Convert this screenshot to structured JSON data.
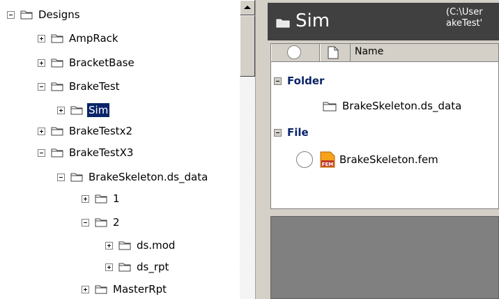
{
  "tree": {
    "nodes": [
      {
        "label": "Designs",
        "expander": "minus"
      },
      {
        "label": "AmpRack",
        "expander": "plus"
      },
      {
        "label": "BracketBase",
        "expander": "plus"
      },
      {
        "label": "BrakeTest",
        "expander": "minus"
      },
      {
        "label": "Sim",
        "expander": "plus",
        "selected": true
      },
      {
        "label": "BrakeTestx2",
        "expander": "plus"
      },
      {
        "label": "BrakeTestX3",
        "expander": "minus"
      },
      {
        "label": "BrakeSkeleton.ds_data",
        "expander": "minus"
      },
      {
        "label": "1",
        "expander": "plus"
      },
      {
        "label": "2",
        "expander": "minus"
      },
      {
        "label": "ds.mod",
        "expander": "plus"
      },
      {
        "label": "ds_rpt",
        "expander": "plus"
      },
      {
        "label": "MasterRpt",
        "expander": "plus"
      }
    ]
  },
  "details": {
    "title": "Sim",
    "path_line1": "(C:\\User",
    "path_line2": "akeTest'",
    "columns": {
      "name": "Name"
    },
    "groups": [
      {
        "label": "Folder",
        "items": [
          {
            "name": "BrakeSkeleton.ds_data",
            "icon": "folder-icon"
          }
        ]
      },
      {
        "label": "File",
        "items": [
          {
            "name": "BrakeSkeleton.fem",
            "icon": "fem-file-icon"
          }
        ]
      }
    ]
  },
  "colors": {
    "selection": "#0a246a",
    "header_bg": "#404040",
    "panel_bg": "#d4d0c8"
  }
}
